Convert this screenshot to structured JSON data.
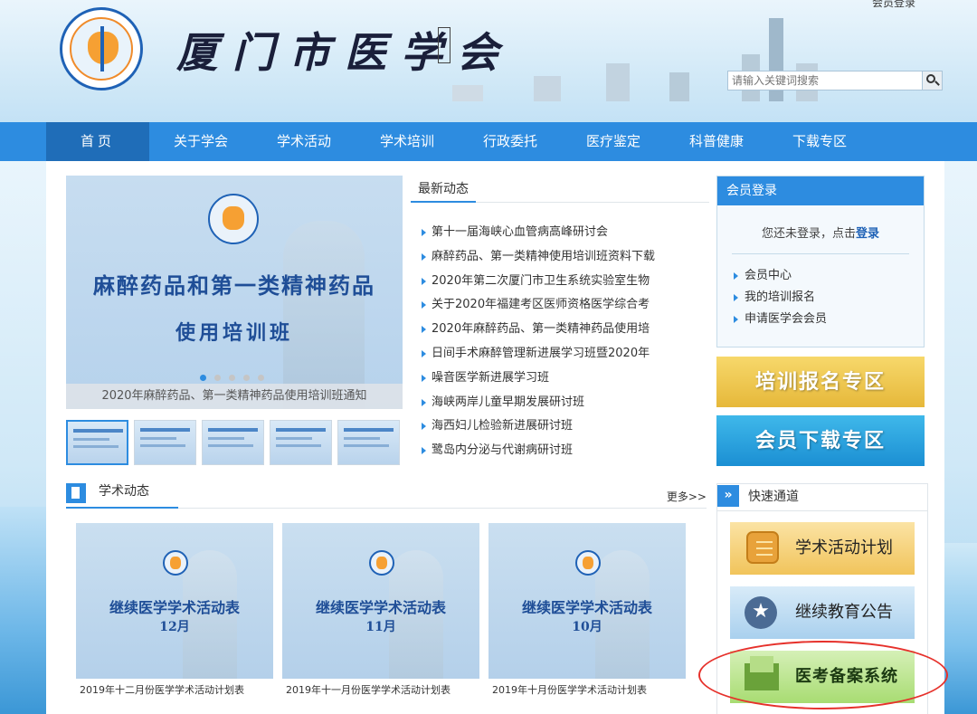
{
  "header": {
    "title": "厦门市医学会",
    "top_link": "会员登录",
    "search_placeholder": "请输入关键词搜索"
  },
  "nav": [
    {
      "label": "首页"
    },
    {
      "label": "关于学会"
    },
    {
      "label": "学术活动"
    },
    {
      "label": "学术培训"
    },
    {
      "label": "行政委托"
    },
    {
      "label": "医疗鉴定"
    },
    {
      "label": "科普健康"
    },
    {
      "label": "下载专区"
    }
  ],
  "slider": {
    "headline_1": "麻醉药品和第一类精神药品",
    "headline_2": "使用培训班",
    "caption": "2020年麻醉药品、第一类精神药品使用培训班通知",
    "active_dot": 0,
    "dot_count": 5,
    "thumb_count": 5
  },
  "latest_news": {
    "title": "最新动态",
    "items": [
      "第十一届海峡心血管病高峰研讨会",
      "麻醉药品、第一类精神使用培训班资料下载",
      "2020年第二次厦门市卫生系统实验室生物",
      "关于2020年福建考区医师资格医学综合考",
      "2020年麻醉药品、第一类精神药品使用培",
      "日间手术麻醉管理新进展学习班暨2020年",
      "噪音医学新进展学习班",
      "海峡两岸儿童早期发展研讨班",
      "海西妇儿检验新进展研讨班",
      "鹭岛内分泌与代谢病研讨班"
    ]
  },
  "member": {
    "title": "会员登录",
    "prompt": "您还未登录，点击",
    "login_link": "登录",
    "links": [
      "会员中心",
      "我的培训报名",
      "申请医学会会员"
    ]
  },
  "banners": {
    "training": "培训报名专区",
    "download": "会员下载专区"
  },
  "academic": {
    "title": "学术动态",
    "more": "更多>>",
    "cards": [
      {
        "line1": "继续医学学术活动表",
        "line2": "12月",
        "caption": "2019年十二月份医学学术活动计划表"
      },
      {
        "line1": "继续医学学术活动表",
        "line2": "11月",
        "caption": "2019年十一月份医学学术活动计划表"
      },
      {
        "line1": "继续医学学术活动表",
        "line2": "10月",
        "caption": "2019年十月份医学学术活动计划表"
      }
    ]
  },
  "quick": {
    "title": "快速通道",
    "icon_glyph": "»",
    "buttons": [
      {
        "label": "学术活动计划"
      },
      {
        "label": "继续教育公告",
        "icon_glyph": "★"
      },
      {
        "label": "医考备案系统"
      }
    ]
  },
  "colors": {
    "accent": "#2d8ce0",
    "nav_active": "#1f6db8",
    "highlight": "#e6312b"
  }
}
